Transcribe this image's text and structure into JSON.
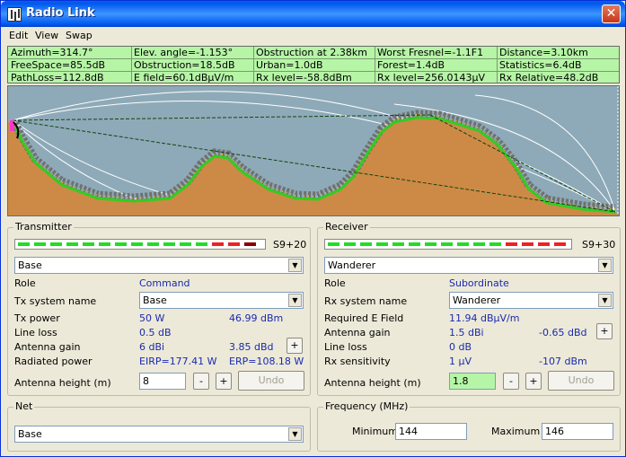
{
  "window": {
    "title": "Radio Link",
    "close_glyph": "✕"
  },
  "menu": [
    "Edit",
    "View",
    "Swap"
  ],
  "info": {
    "row1": [
      "Azimuth=314.7°",
      "Elev. angle=-1.153°",
      "Obstruction at 2.38km",
      "Worst Fresnel=-1.1F1",
      "Distance=3.10km"
    ],
    "row2": [
      "FreeSpace=85.5dB",
      "Obstruction=18.5dB",
      "Urban=1.0dB",
      "Forest=1.4dB",
      "Statistics=6.4dB"
    ],
    "row3": [
      "PathLoss=112.8dB",
      "E field=60.1dBµV/m",
      "Rx level=-58.8dBm",
      "Rx level=256.0143µV",
      "Rx Relative=48.2dB"
    ]
  },
  "transmitter": {
    "group_label": "Transmitter",
    "signal_label": "S9+20",
    "unit_select": "Base",
    "role_label": "Role",
    "role_value": "Command",
    "system_label": "Tx system name",
    "system_value": "Base",
    "power_label": "Tx power",
    "power_w": "50 W",
    "power_dbm": "46.99 dBm",
    "lineloss_label": "Line loss",
    "lineloss_value": "0.5 dB",
    "gain_label": "Antenna gain",
    "gain_dbi": "6 dBi",
    "gain_dbd": "3.85 dBd",
    "radiated_label": "Radiated power",
    "eirp": "EIRP=177.41 W",
    "erp": "ERP=108.18 W",
    "height_label": "Antenna height (m)",
    "height_value": "8",
    "minus": "-",
    "plus": "+",
    "undo": "Undo"
  },
  "receiver": {
    "group_label": "Receiver",
    "signal_label": "S9+30",
    "unit_select": "Wanderer",
    "role_label": "Role",
    "role_value": "Subordinate",
    "system_label": "Rx system name",
    "system_value": "Wanderer",
    "efield_label": "Required E Field",
    "efield_value": "11.94 dBµV/m",
    "gain_label": "Antenna gain",
    "gain_dbi": "1.5 dBi",
    "gain_dbd": "-0.65 dBd",
    "lineloss_label": "Line loss",
    "lineloss_value": "0 dB",
    "sens_label": "Rx sensitivity",
    "sens_uv": "1 µV",
    "sens_dbm": "-107 dBm",
    "height_label": "Antenna height (m)",
    "height_value": "1.8",
    "minus": "-",
    "plus": "+",
    "undo": "Undo"
  },
  "net": {
    "group_label": "Net",
    "value": "Base"
  },
  "frequency": {
    "group_label": "Frequency (MHz)",
    "min_label": "Minimum",
    "min_value": "144",
    "max_label": "Maximum",
    "max_value": "146"
  },
  "colors": {
    "terrain": "#cd8a46",
    "sky": "#8eaab8",
    "fresnel": "#ffffff",
    "ground_line": "#33cc22",
    "info_bg": "#b6f5a6"
  }
}
